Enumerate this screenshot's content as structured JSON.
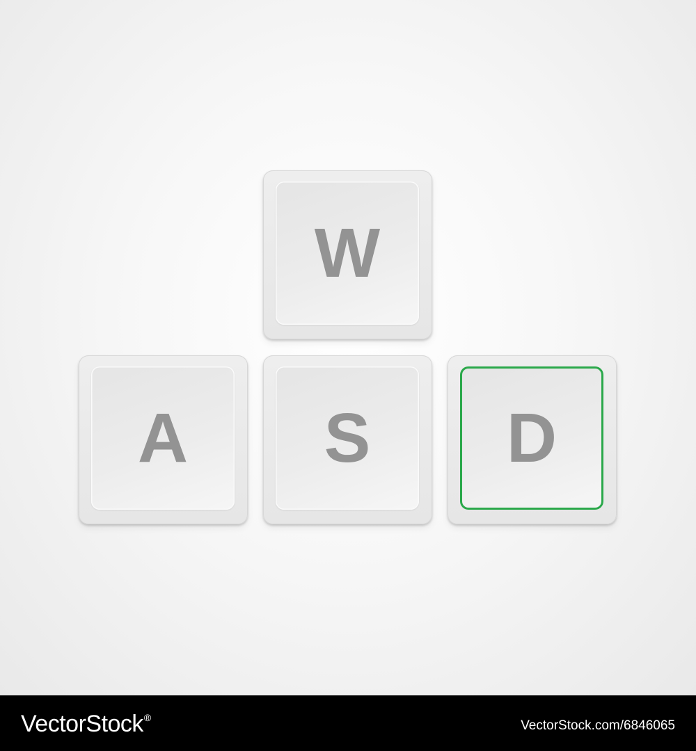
{
  "keys": [
    {
      "id": "w",
      "label": "W",
      "selected": false
    },
    {
      "id": "a",
      "label": "A",
      "selected": false
    },
    {
      "id": "s",
      "label": "S",
      "selected": false
    },
    {
      "id": "d",
      "label": "D",
      "selected": true
    }
  ],
  "colors": {
    "selection_outline": "#2aa84a",
    "letter": "#939393",
    "footer_background": "#000000"
  },
  "footer": {
    "brand": "VectorStock",
    "brand_mark": "®",
    "image_url_text": "VectorStock.com/6846065"
  }
}
